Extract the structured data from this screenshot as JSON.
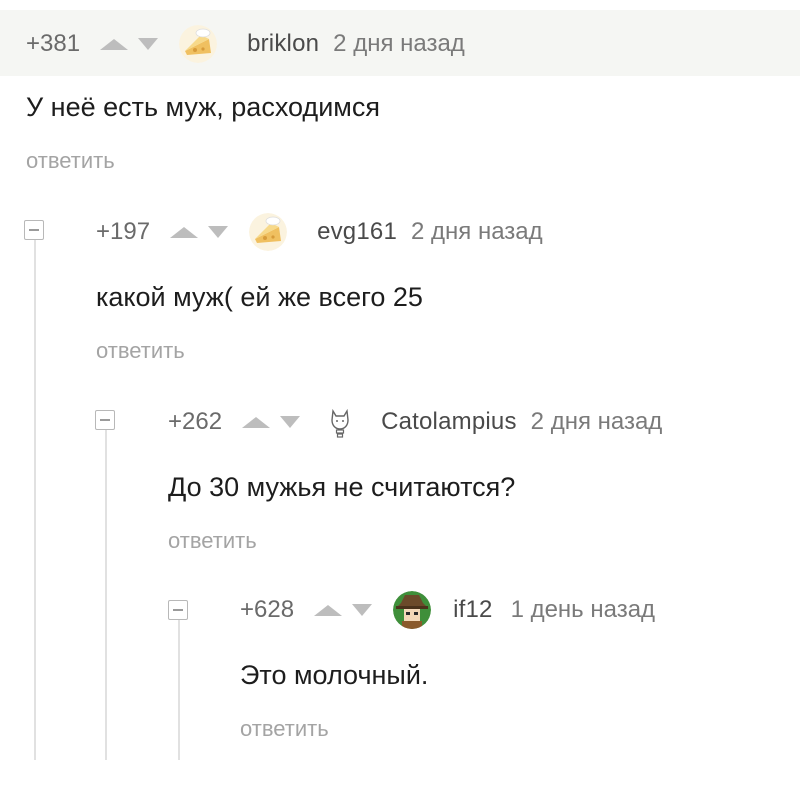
{
  "comments": [
    {
      "rating": "+381",
      "username": "briklon",
      "date": "2 дня назад",
      "text": "У неё есть муж, расходимся",
      "reply_label": "ответить",
      "avatar_icon": "cheese-avatar-icon"
    },
    {
      "rating": "+197",
      "username": "evg161",
      "date": "2 дня назад",
      "text": "какой муж( ей же всего 25",
      "reply_label": "ответить",
      "avatar_icon": "cheese-avatar-icon"
    },
    {
      "rating": "+262",
      "username": "Catolampius",
      "date": "2 дня назад",
      "text": "До 30 мужья не считаются?",
      "reply_label": "ответить",
      "avatar_icon": "cat-lightbulb-avatar-icon"
    },
    {
      "rating": "+628",
      "username": "if12",
      "date": "1 день назад",
      "text": "Это молочный.",
      "reply_label": "ответить",
      "avatar_icon": "hat-character-avatar-icon"
    }
  ],
  "colors": {
    "rating": "#6a6a6a",
    "reply": "#a4a4a4",
    "thread_line": "#e1e1e1",
    "header_bg": "#f5f6f3"
  }
}
